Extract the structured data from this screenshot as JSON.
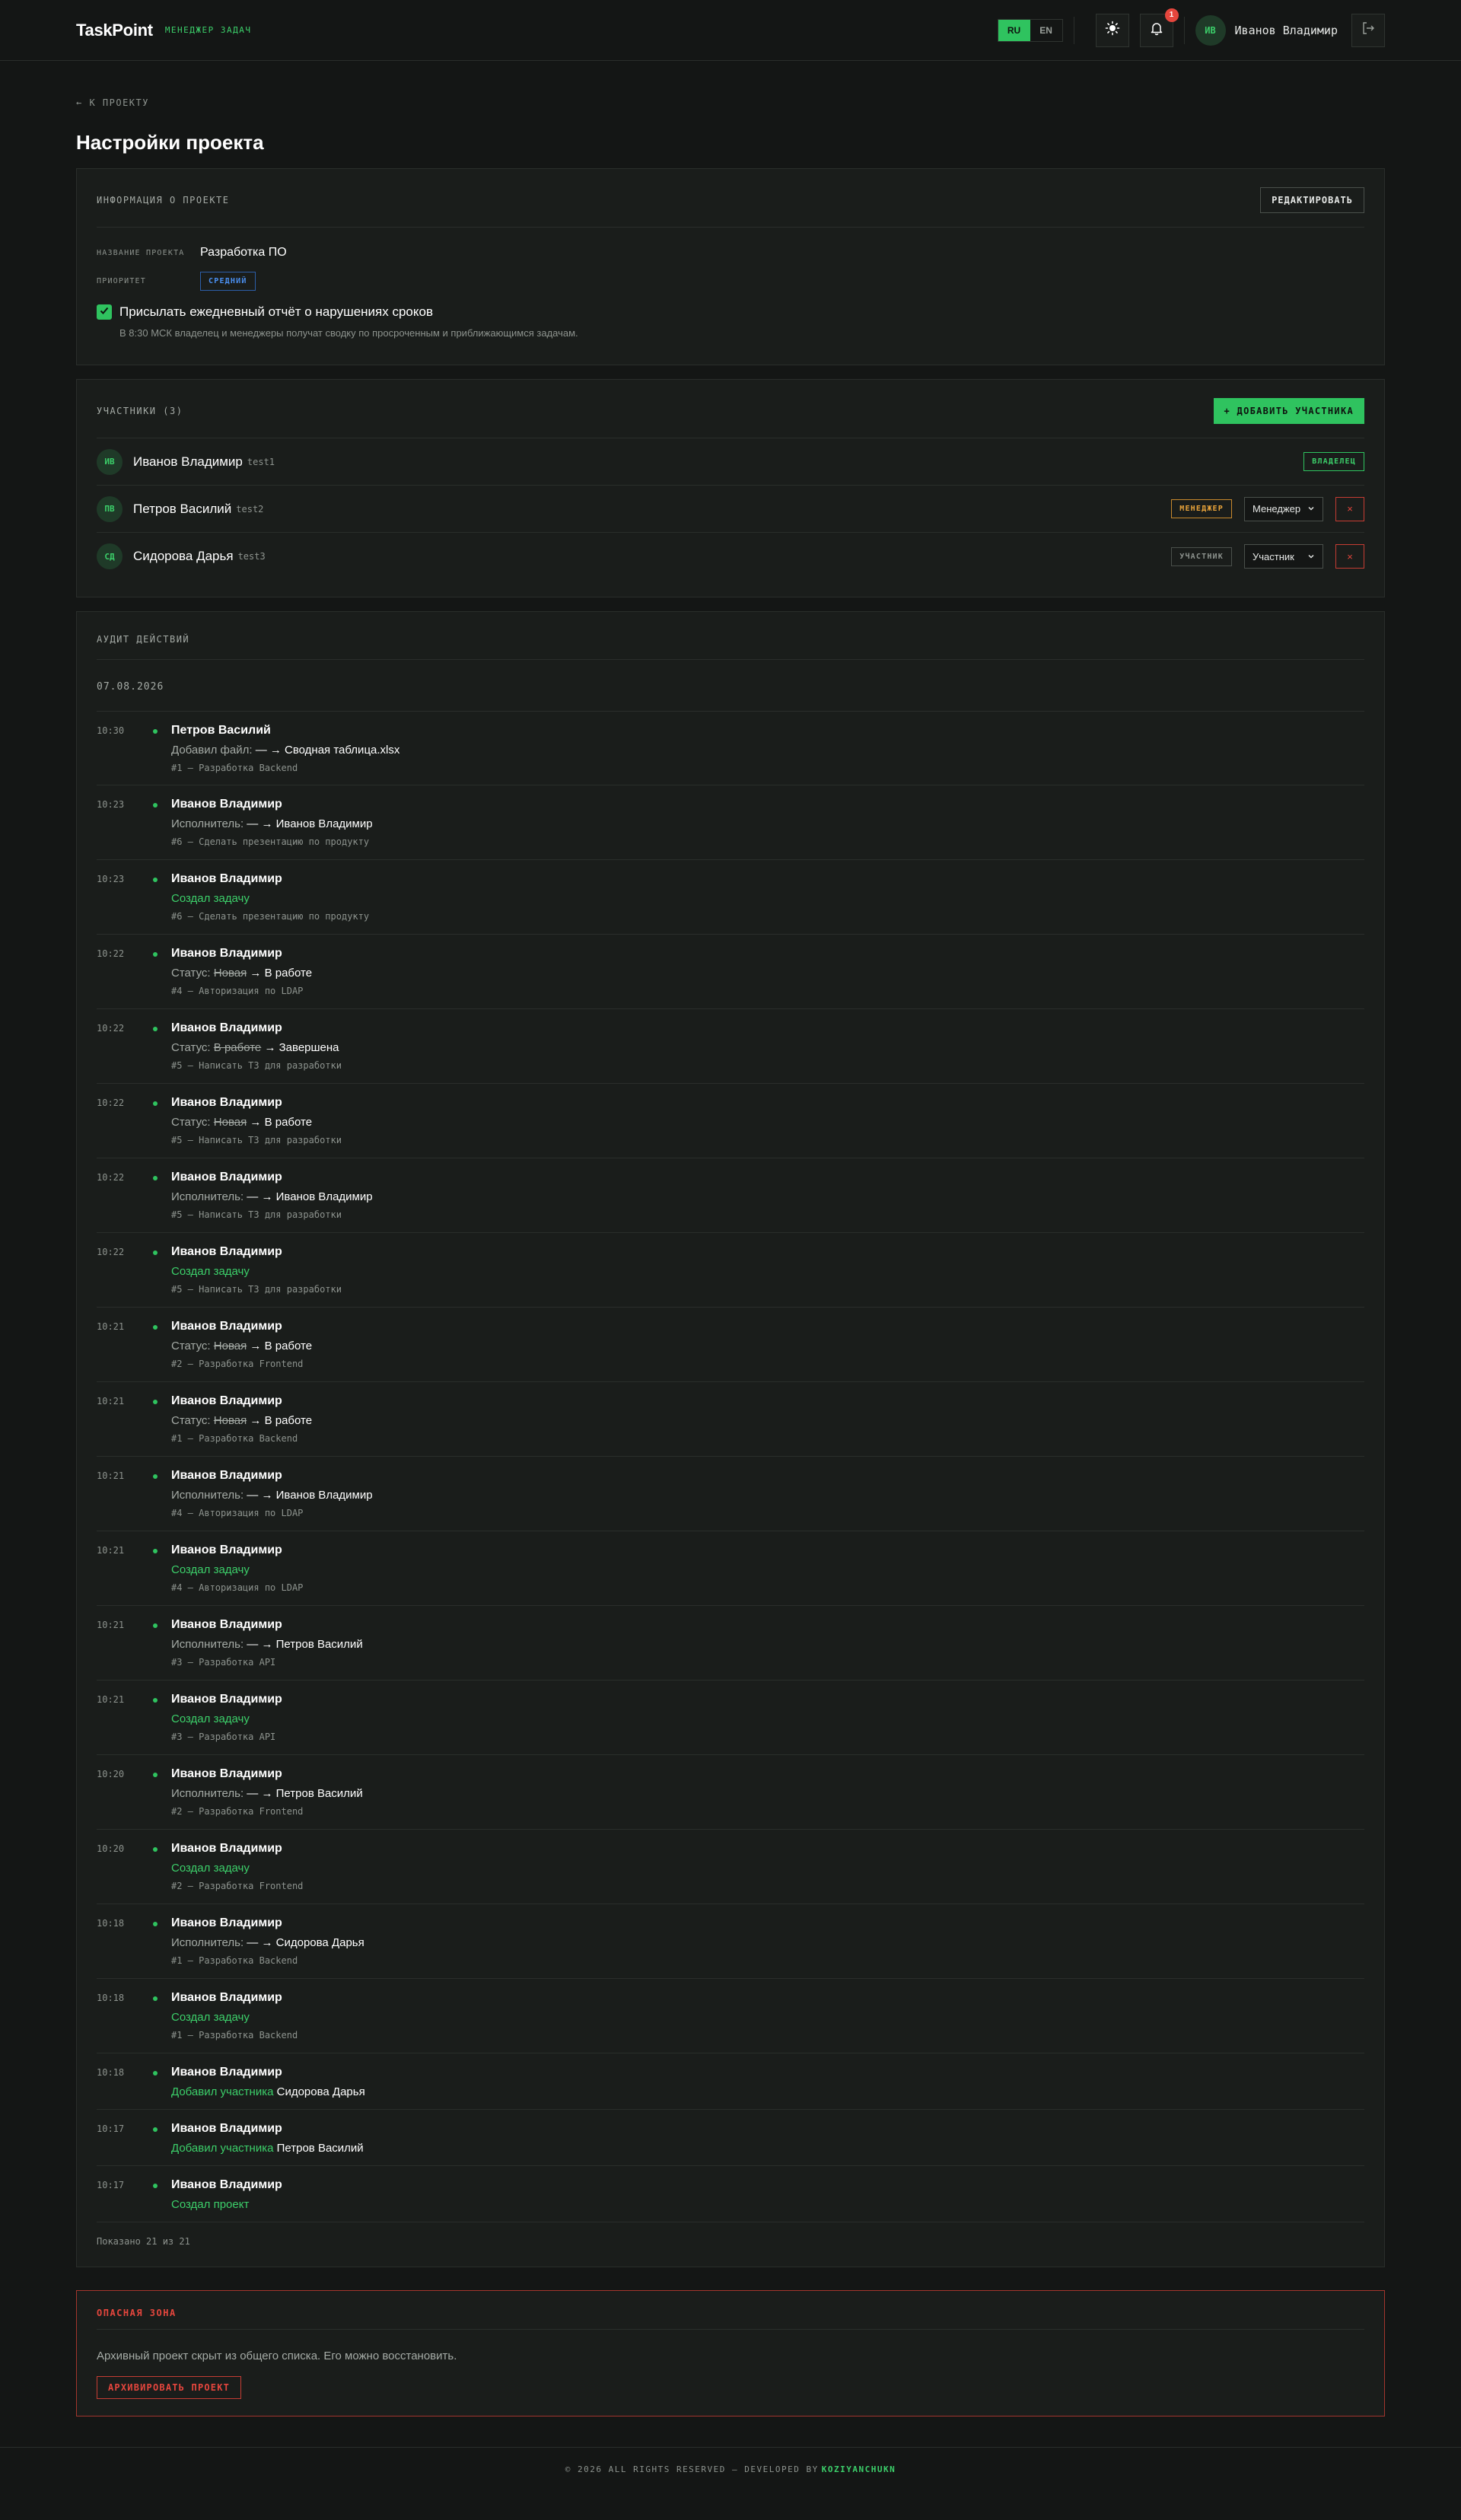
{
  "header": {
    "logo": "TaskPoint",
    "logo_sub": "МЕНЕДЖЕР ЗАДАЧ",
    "lang_ru": "RU",
    "lang_en": "EN",
    "notifications_count": "1",
    "user_initials": "ИВ",
    "user_name": "Иванов Владимир"
  },
  "nav": {
    "back_label": "← К ПРОЕКТУ"
  },
  "page": {
    "title": "Настройки проекта"
  },
  "info": {
    "section_title": "ИНФОРМАЦИЯ О ПРОЕКТЕ",
    "edit_label": "РЕДАКТИРОВАТЬ",
    "name_label": "НАЗВАНИЕ ПРОЕКТА",
    "name_value": "Разработка ПО",
    "priority_label": "ПРИОРИТЕТ",
    "priority_value": "СРЕДНИЙ",
    "report_label": "Присылать ежедневный отчёт о нарушениях сроков",
    "report_checked": true,
    "report_hint": "В 8:30 МСК владелец и менеджеры получат сводку по просроченным и приближающимся задачам."
  },
  "members": {
    "section_title": "УЧАСТНИКИ (3)",
    "add_label": "+ ДОБАВИТЬ УЧАСТНИКА",
    "items": [
      {
        "initials": "ИВ",
        "name": "Иванов Владимир",
        "login": "test1",
        "role_tag": "ВЛАДЕЛЕЦ",
        "role_select": "",
        "remove": ""
      },
      {
        "initials": "ПВ",
        "name": "Петров Василий",
        "login": "test2",
        "role_tag": "МЕНЕДЖЕР",
        "role_select": "Менеджер",
        "remove": "×"
      },
      {
        "initials": "СД",
        "name": "Сидорова Дарья",
        "login": "test3",
        "role_tag": "УЧАСТНИК",
        "role_select": "Участник",
        "remove": "×"
      }
    ]
  },
  "audit": {
    "section_title": "АУДИТ ДЕЙСТВИЙ",
    "date": "07.08.2026",
    "shown": "Показано 21 из 21",
    "items": [
      {
        "time": "10:30",
        "user": "Петров Василий",
        "kind": "change",
        "prefix": "Добавил файл:",
        "old": "",
        "arrow": "— →",
        "new": "Сводная таблица.xlsx",
        "task": "#1 — Разработка Backend"
      },
      {
        "time": "10:23",
        "user": "Иванов Владимир",
        "kind": "change",
        "prefix": "Исполнитель:",
        "old": "",
        "arrow": "— →",
        "new": "Иванов Владимир",
        "task": "#6 — Сделать презентацию по продукту"
      },
      {
        "time": "10:23",
        "user": "Иванов Владимир",
        "kind": "green",
        "prefix": "Создал задачу",
        "old": "",
        "arrow": "",
        "new": "",
        "task": "#6 — Сделать презентацию по продукту"
      },
      {
        "time": "10:22",
        "user": "Иванов Владимир",
        "kind": "change",
        "prefix": "Статус:",
        "old": "Новая",
        "arrow": "→",
        "new": "В работе",
        "task": "#4 — Авторизация по LDAP"
      },
      {
        "time": "10:22",
        "user": "Иванов Владимир",
        "kind": "change",
        "prefix": "Статус:",
        "old": "В работе",
        "arrow": "→",
        "new": "Завершена",
        "task": "#5 — Написать ТЗ для разработки"
      },
      {
        "time": "10:22",
        "user": "Иванов Владимир",
        "kind": "change",
        "prefix": "Статус:",
        "old": "Новая",
        "arrow": "→",
        "new": "В работе",
        "task": "#5 — Написать ТЗ для разработки"
      },
      {
        "time": "10:22",
        "user": "Иванов Владимир",
        "kind": "change",
        "prefix": "Исполнитель:",
        "old": "",
        "arrow": "— →",
        "new": "Иванов Владимир",
        "task": "#5 — Написать ТЗ для разработки"
      },
      {
        "time": "10:22",
        "user": "Иванов Владимир",
        "kind": "green",
        "prefix": "Создал задачу",
        "old": "",
        "arrow": "",
        "new": "",
        "task": "#5 — Написать ТЗ для разработки"
      },
      {
        "time": "10:21",
        "user": "Иванов Владимир",
        "kind": "change",
        "prefix": "Статус:",
        "old": "Новая",
        "arrow": "→",
        "new": "В работе",
        "task": "#2 — Разработка Frontend"
      },
      {
        "time": "10:21",
        "user": "Иванов Владимир",
        "kind": "change",
        "prefix": "Статус:",
        "old": "Новая",
        "arrow": "→",
        "new": "В работе",
        "task": "#1 — Разработка Backend"
      },
      {
        "time": "10:21",
        "user": "Иванов Владимир",
        "kind": "change",
        "prefix": "Исполнитель:",
        "old": "",
        "arrow": "— →",
        "new": "Иванов Владимир",
        "task": "#4 — Авторизация по LDAP"
      },
      {
        "time": "10:21",
        "user": "Иванов Владимир",
        "kind": "green",
        "prefix": "Создал задачу",
        "old": "",
        "arrow": "",
        "new": "",
        "task": "#4 — Авторизация по LDAP"
      },
      {
        "time": "10:21",
        "user": "Иванов Владимир",
        "kind": "change",
        "prefix": "Исполнитель:",
        "old": "",
        "arrow": "— →",
        "new": "Петров Василий",
        "task": "#3 — Разработка API"
      },
      {
        "time": "10:21",
        "user": "Иванов Владимир",
        "kind": "green",
        "prefix": "Создал задачу",
        "old": "",
        "arrow": "",
        "new": "",
        "task": "#3 — Разработка API"
      },
      {
        "time": "10:20",
        "user": "Иванов Владимир",
        "kind": "change",
        "prefix": "Исполнитель:",
        "old": "",
        "arrow": "— →",
        "new": "Петров Василий",
        "task": "#2 — Разработка Frontend"
      },
      {
        "time": "10:20",
        "user": "Иванов Владимир",
        "kind": "green",
        "prefix": "Создал задачу",
        "old": "",
        "arrow": "",
        "new": "",
        "task": "#2 — Разработка Frontend"
      },
      {
        "time": "10:18",
        "user": "Иванов Владимир",
        "kind": "change",
        "prefix": "Исполнитель:",
        "old": "",
        "arrow": "— →",
        "new": "Сидорова Дарья",
        "task": "#1 — Разработка Backend"
      },
      {
        "time": "10:18",
        "user": "Иванов Владимир",
        "kind": "green",
        "prefix": "Создал задачу",
        "old": "",
        "arrow": "",
        "new": "",
        "task": "#1 — Разработка Backend"
      },
      {
        "time": "10:18",
        "user": "Иванов Владимир",
        "kind": "green",
        "prefix": "Добавил участника",
        "old": "",
        "arrow": "",
        "new": "Сидорова Дарья",
        "task": ""
      },
      {
        "time": "10:17",
        "user": "Иванов Владимир",
        "kind": "green",
        "prefix": "Добавил участника",
        "old": "",
        "arrow": "",
        "new": "Петров Василий",
        "task": ""
      },
      {
        "time": "10:17",
        "user": "Иванов Владимир",
        "kind": "green",
        "prefix": "Создал проект",
        "old": "",
        "arrow": "",
        "new": "",
        "task": ""
      }
    ]
  },
  "danger": {
    "title": "ОПАСНАЯ ЗОНА",
    "text": "Архивный проект скрыт из общего списка. Его можно восстановить.",
    "archive_label": "АРХИВИРОВАТЬ ПРОЕКТ"
  },
  "footer": {
    "text": "© 2026 ALL RIGHTS RESERVED — DEVELOPED BY",
    "author": "KOZIYANCHUKN"
  },
  "colors": {
    "accent": "#2fc35f",
    "danger": "#e5463d",
    "warning": "#e8a33a",
    "info": "#4a8ff0",
    "background": "#141615"
  },
  "icons": {
    "theme": "sun-icon",
    "notifications": "bell-icon",
    "logout": "logout-icon",
    "checkbox": "check-icon",
    "select": "chevron-down-icon"
  }
}
